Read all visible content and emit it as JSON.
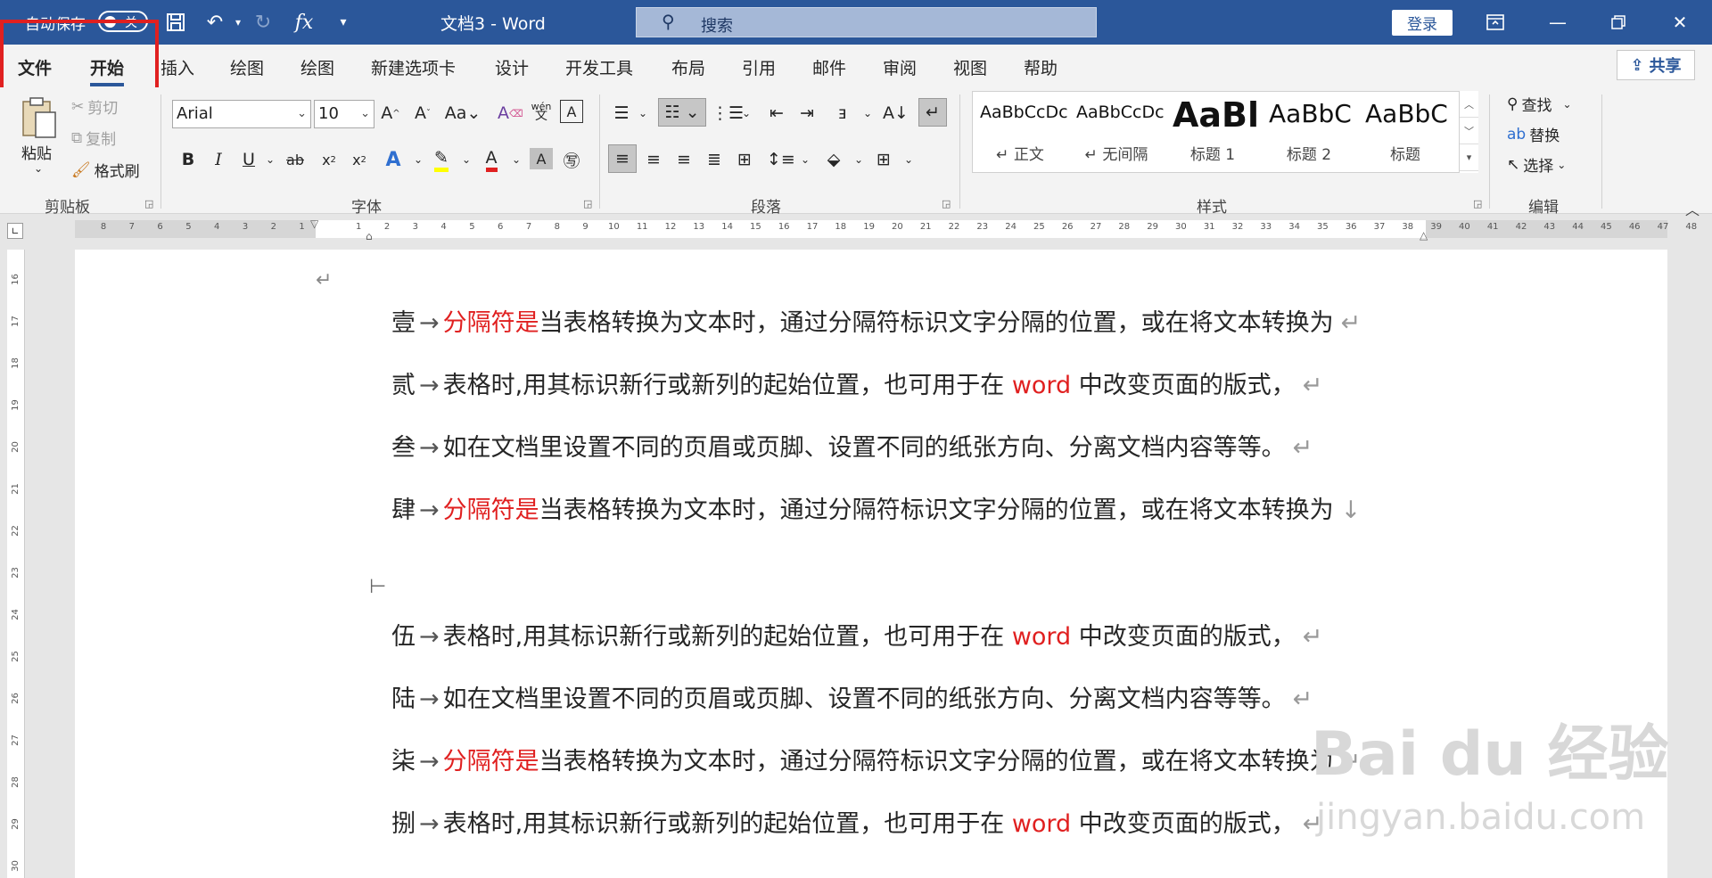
{
  "titlebar": {
    "autosave_label": "自动保存",
    "autosave_state": "关",
    "doc_title": "文档3 - Word",
    "search_placeholder": "搜索",
    "login_label": "登录"
  },
  "tabs": [
    "文件",
    "开始",
    "插入",
    "绘图",
    "绘图",
    "新建选项卡",
    "设计",
    "开发工具",
    "布局",
    "引用",
    "邮件",
    "审阅",
    "视图",
    "帮助"
  ],
  "share_label": "共享",
  "clipboard": {
    "paste": "粘贴",
    "cut": "剪切",
    "copy": "复制",
    "format_painter": "格式刷",
    "group": "剪贴板"
  },
  "font": {
    "name": "Arial",
    "size": "10",
    "group": "字体"
  },
  "paragraph": {
    "group": "段落"
  },
  "styles": {
    "items": [
      {
        "preview": "AaBbCcDc",
        "name": "↵ 正文"
      },
      {
        "preview": "AaBbCcDc",
        "name": "↵ 无间隔"
      },
      {
        "preview": "AaBl",
        "name": "标题 1"
      },
      {
        "preview": "AaBbC",
        "name": "标题 2"
      },
      {
        "preview": "AaBbC",
        "name": "标题"
      }
    ],
    "group": "样式"
  },
  "editing": {
    "find": "查找",
    "replace": "替换",
    "select": "选择",
    "group": "编辑"
  },
  "ruler_numbers": [
    "8",
    "7",
    "6",
    "5",
    "4",
    "3",
    "2",
    "1",
    "",
    "1",
    "2",
    "3",
    "4",
    "5",
    "6",
    "7",
    "8",
    "9",
    "10",
    "11",
    "12",
    "13",
    "14",
    "15",
    "16",
    "17",
    "18",
    "19",
    "20",
    "21",
    "22",
    "23",
    "24",
    "25",
    "26",
    "27",
    "28",
    "29",
    "30",
    "31",
    "32",
    "33",
    "34",
    "35",
    "36",
    "37",
    "38",
    "39",
    "40",
    "41",
    "42",
    "43",
    "44",
    "45",
    "46",
    "47",
    "48"
  ],
  "vruler_numbers": [
    "16",
    "17",
    "18",
    "19",
    "20",
    "21",
    "22",
    "23",
    "24",
    "25",
    "26",
    "27",
    "28",
    "29",
    "30"
  ],
  "document": {
    "lines": [
      {
        "num": "壹",
        "red": "分隔符是",
        "text": "当表格转换为文本时，通过分隔符标识文字分隔的位置，或在将文本转换为",
        "mark": "↵"
      },
      {
        "num": "贰",
        "red": "",
        "text": "表格时,用其标识新行或新列的起始位置，也可用于在",
        "red2": "word",
        "text2": "中改变页面的版式，",
        "mark": "↵"
      },
      {
        "num": "叁",
        "red": "",
        "text": "如在文档里设置不同的页眉或页脚、设置不同的纸张方向、分离文档内容等等。",
        "mark": "↵"
      },
      {
        "num": "肆",
        "red": "分隔符是",
        "text": "当表格转换为文本时，通过分隔符标识文字分隔的位置，或在将文本转换为",
        "mark": "↓"
      },
      {
        "num": "伍",
        "red": "",
        "text": "表格时,用其标识新行或新列的起始位置，也可用于在",
        "red2": "word",
        "text2": "中改变页面的版式，",
        "mark": "↵"
      },
      {
        "num": "陆",
        "red": "",
        "text": "如在文档里设置不同的页眉或页脚、设置不同的纸张方向、分离文档内容等等。",
        "mark": "↵"
      },
      {
        "num": "柒",
        "red": "分隔符是",
        "text": "当表格转换为文本时，通过分隔符标识文字分隔的位置，或在将文本转换为",
        "mark": "↵"
      },
      {
        "num": "捌",
        "red": "",
        "text": "表格时,用其标识新行或新列的起始位置，也可用于在",
        "red2": "word",
        "text2": "中改变页面的版式，",
        "mark": "↵"
      }
    ]
  },
  "watermark": {
    "main": "Bai du 经验",
    "sub": "jingyan.baidu.com"
  },
  "colors": {
    "accent": "#2b579a",
    "highlight": "#e02020"
  }
}
